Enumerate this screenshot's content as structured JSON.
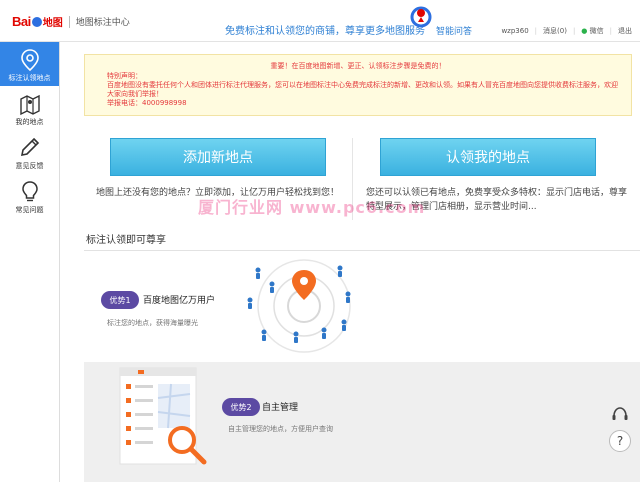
{
  "header": {
    "logo_bai": "Bai",
    "logo_map": "地图",
    "logo_sub": "地图标注中心",
    "promo": "免费标注和认领您的商铺，尊享更多地图服务",
    "promo_link": "智能问答",
    "username": "wzp360",
    "messages": "消息(0)",
    "wechat": "微信",
    "logout": "退出"
  },
  "sidebar": {
    "items": [
      {
        "label": "标注认领地点",
        "icon": "map-pin-icon",
        "active": true
      },
      {
        "label": "我的地点",
        "icon": "folded-map-icon",
        "active": false
      },
      {
        "label": "意见反馈",
        "icon": "pencil-icon",
        "active": false
      },
      {
        "label": "常见问题",
        "icon": "lightbulb-icon",
        "active": false
      }
    ]
  },
  "notice": {
    "title": "重要！在百度地图新增、更正、认领标注步骤是免费的！",
    "lines": [
      "特别声明：",
      "百度地图没有委托任何个人和团体进行标注代理服务，您可以在地图标注中心免费完成标注的新增、更改和认领。如果有人冒充百度地图向您提供收费标注服务，欢迎大家向我们举报！",
      "举报电话：4000998998"
    ]
  },
  "actions": {
    "add_label": "添加新地点",
    "add_desc": "地图上还没有您的地点？立即添加，让亿万用户轻松找到您！",
    "claim_label": "认领我的地点",
    "claim_desc": "您还可以认领已有地点，免费享受众多特权：显示门店电话，尊享特型展示，管理门店相册，显示营业时间..."
  },
  "watermark": "厦门行业网  www.pc6.com",
  "benefits": {
    "section_title": "标注认领即可尊享",
    "items": [
      {
        "badge": "优势1",
        "title": "百度地图亿万用户",
        "desc": "标注您的地点，获得海量曝光"
      },
      {
        "badge": "优势2",
        "title": "自主管理",
        "desc": "自主管理您的地点，方便用户查询"
      }
    ]
  },
  "floating": {
    "help": "?"
  },
  "colors": {
    "brand_red": "#e10601",
    "accent_blue": "#3385e6",
    "button_cyan": "#3ab1e0",
    "badge_purple": "#5c4aa3",
    "notice_red": "#e4393c",
    "pin_orange": "#f36c21"
  }
}
